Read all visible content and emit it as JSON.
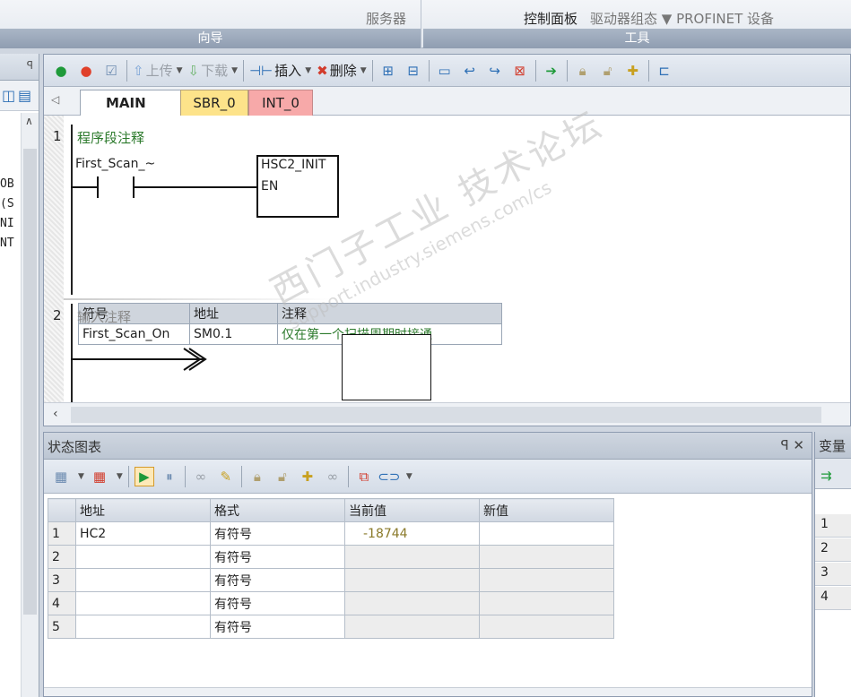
{
  "ribbon": {
    "groups": [
      {
        "caption": "向导",
        "text1": "服务器"
      },
      {
        "caption": "工具",
        "text_dark": "控制面板",
        "text2": "驱动器组态 ▼ PROFINET 设备"
      }
    ]
  },
  "editor": {
    "toolbar": {
      "upload_label": "上传",
      "download_label": "下载",
      "insert_label": "插入",
      "delete_label": "删除"
    },
    "tabs": [
      {
        "label": "MAIN",
        "close": "✕"
      },
      {
        "label": "SBR_0"
      },
      {
        "label": "INT_0"
      }
    ],
    "networks": [
      {
        "number": "1",
        "comment": "程序段注释",
        "contact_label": "First_Scan_~",
        "box_title": "HSC2_INIT",
        "box_pin": "EN",
        "symbol_table": {
          "headers": [
            "符号",
            "地址",
            "注释"
          ],
          "rows": [
            [
              "First_Scan_On",
              "SM0.1",
              "仅在第一个扫描周期时接通"
            ]
          ]
        }
      },
      {
        "number": "2",
        "comment": "输入注释"
      }
    ]
  },
  "left_panel": {
    "lines": [
      "OB",
      "(S",
      "NI",
      "NT"
    ]
  },
  "status_chart": {
    "title": "状态图表",
    "controls": "ꟼ ✕",
    "headers": [
      "",
      "地址",
      "格式",
      "当前值",
      "新值"
    ],
    "rows": [
      {
        "n": "1",
        "address": "HC2",
        "format": "有符号",
        "current": "-18744",
        "new": ""
      },
      {
        "n": "2",
        "address": "",
        "format": "有符号",
        "current": "",
        "new": ""
      },
      {
        "n": "3",
        "address": "",
        "format": "有符号",
        "current": "",
        "new": ""
      },
      {
        "n": "4",
        "address": "",
        "format": "有符号",
        "current": "",
        "new": ""
      },
      {
        "n": "5",
        "address": "",
        "format": "有符号",
        "current": "",
        "new": ""
      }
    ]
  },
  "right_panel": {
    "title": "变量",
    "rows": [
      "1",
      "2",
      "3",
      "4"
    ]
  },
  "watermark": {
    "line1": "西门子工业 技术论坛",
    "line2": "support.industry.siemens.com/cs"
  },
  "colors": {
    "tab_sbr": "#fde38a",
    "tab_int": "#f7a9a9",
    "comment_green": "#2c7a2c",
    "current_value": "#8a7a2a"
  }
}
